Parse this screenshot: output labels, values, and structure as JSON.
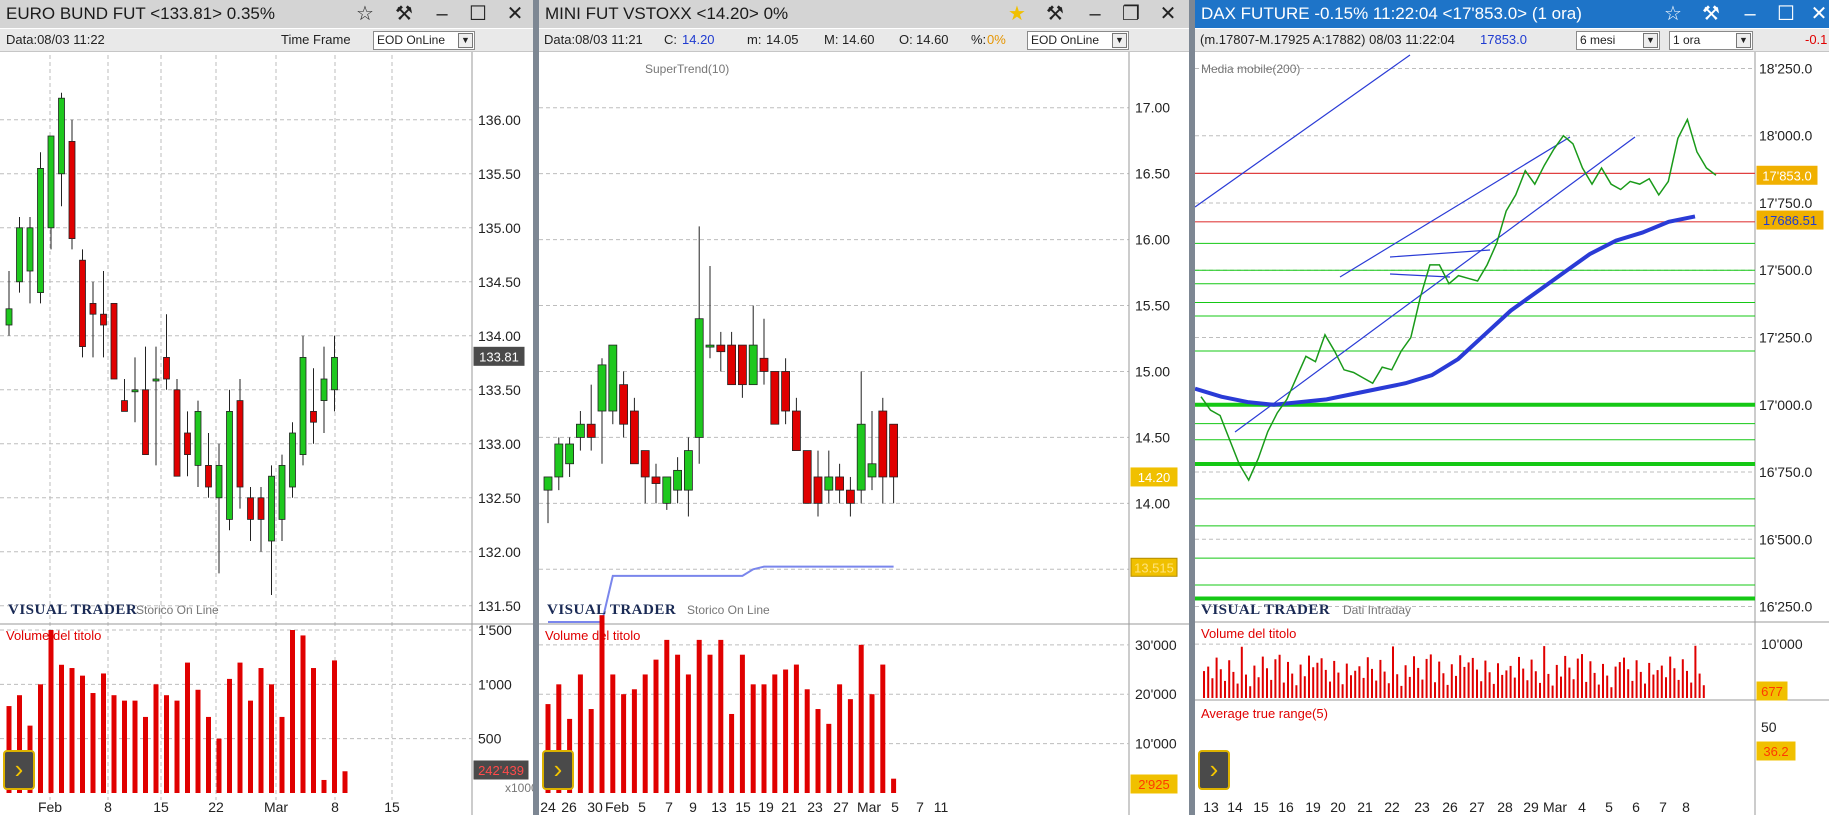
{
  "colors": {
    "up": "#1ec81e",
    "down": "#e00000",
    "title_bg": "#d4d4d4",
    "frame": "#1e74c8",
    "star_active": "#f0c000",
    "sma": "#2a3bd6",
    "supertrend": "#7a86ec"
  },
  "icons": {
    "star": "star-icon",
    "pin": "pin-icon",
    "minimize": "minimize-icon",
    "maximize": "maximize-icon",
    "restore": "restore-icon",
    "close": "close-icon",
    "nav": "chevron-right-icon"
  },
  "brand": {
    "name": "VISUAL TRADER"
  },
  "pane1": {
    "title": "EURO BUND FUT <133.81> 0.35%",
    "info": {
      "data": "Data:08/03 11:22",
      "timeframe_label": "Time Frame",
      "timeframe_value": "EOD OnLine"
    },
    "brand_sub": "Storico On Line",
    "price_badge": "133.81",
    "volume_label": "Volume del titolo",
    "volume_badge": "242'439",
    "volume_unit": "x1000",
    "chart_data": {
      "type": "candlestick",
      "title": "EURO BUND FUT",
      "y_ticks": [
        "136.00",
        "135.50",
        "135.00",
        "134.50",
        "134.00",
        "133.50",
        "133.00",
        "132.50",
        "132.00",
        "131.50"
      ],
      "ylim": [
        131.35,
        136.6
      ],
      "x_labels": [
        "Feb",
        "8",
        "15",
        "22",
        "Mar",
        "8",
        "15"
      ],
      "candles": [
        {
          "o": 134.1,
          "h": 134.6,
          "l": 134.0,
          "c": 134.25
        },
        {
          "o": 134.5,
          "h": 135.1,
          "l": 134.4,
          "c": 135.0
        },
        {
          "o": 134.6,
          "h": 135.1,
          "l": 134.3,
          "c": 135.0
        },
        {
          "o": 134.4,
          "h": 135.7,
          "l": 134.3,
          "c": 135.55
        },
        {
          "o": 135.0,
          "h": 135.85,
          "l": 134.8,
          "c": 135.85
        },
        {
          "o": 135.5,
          "h": 136.25,
          "l": 135.2,
          "c": 136.2
        },
        {
          "o": 135.8,
          "h": 136.0,
          "l": 134.8,
          "c": 134.9
        },
        {
          "o": 134.7,
          "h": 134.8,
          "l": 133.8,
          "c": 133.9
        },
        {
          "o": 134.3,
          "h": 134.5,
          "l": 133.8,
          "c": 134.2
        },
        {
          "o": 134.2,
          "h": 134.6,
          "l": 133.8,
          "c": 134.1
        },
        {
          "o": 134.3,
          "h": 134.3,
          "l": 133.6,
          "c": 133.6
        },
        {
          "o": 133.4,
          "h": 133.6,
          "l": 133.3,
          "c": 133.3
        },
        {
          "o": 133.5,
          "h": 133.8,
          "l": 133.2,
          "c": 133.5
        },
        {
          "o": 133.5,
          "h": 133.9,
          "l": 132.9,
          "c": 132.9
        },
        {
          "o": 133.6,
          "h": 133.9,
          "l": 132.8,
          "c": 133.6
        },
        {
          "o": 133.8,
          "h": 134.2,
          "l": 133.5,
          "c": 133.6
        },
        {
          "o": 133.5,
          "h": 133.6,
          "l": 132.7,
          "c": 132.7
        },
        {
          "o": 133.1,
          "h": 133.3,
          "l": 132.7,
          "c": 132.9
        },
        {
          "o": 132.8,
          "h": 133.4,
          "l": 132.6,
          "c": 133.3
        },
        {
          "o": 132.8,
          "h": 133.1,
          "l": 132.5,
          "c": 132.6
        },
        {
          "o": 132.5,
          "h": 133.0,
          "l": 131.8,
          "c": 132.8
        },
        {
          "o": 132.3,
          "h": 133.5,
          "l": 132.2,
          "c": 133.3
        },
        {
          "o": 133.4,
          "h": 133.6,
          "l": 132.4,
          "c": 132.6
        },
        {
          "o": 132.5,
          "h": 132.6,
          "l": 132.1,
          "c": 132.3
        },
        {
          "o": 132.5,
          "h": 132.6,
          "l": 132.0,
          "c": 132.3
        },
        {
          "o": 132.1,
          "h": 132.8,
          "l": 131.6,
          "c": 132.7
        },
        {
          "o": 132.3,
          "h": 132.9,
          "l": 132.1,
          "c": 132.8
        },
        {
          "o": 132.6,
          "h": 133.2,
          "l": 132.5,
          "c": 133.1
        },
        {
          "o": 132.9,
          "h": 134.0,
          "l": 132.8,
          "c": 133.8
        },
        {
          "o": 133.3,
          "h": 133.7,
          "l": 133.0,
          "c": 133.2
        },
        {
          "o": 133.4,
          "h": 133.9,
          "l": 133.1,
          "c": 133.6
        },
        {
          "o": 133.5,
          "h": 134.0,
          "l": 133.3,
          "c": 133.8
        }
      ],
      "volume_ticks": [
        "1'500",
        "1'000",
        "500"
      ],
      "volume_ylim": [
        0,
        1500
      ],
      "volume": [
        800,
        900,
        620,
        1000,
        1500,
        1180,
        1150,
        1080,
        920,
        1100,
        900,
        850,
        850,
        700,
        1000,
        900,
        850,
        1200,
        950,
        700,
        500,
        1050,
        1200,
        850,
        1150,
        1000,
        700,
        1500,
        1450,
        1150,
        120,
        1220,
        200
      ]
    }
  },
  "pane2": {
    "title": "MINI FUT VSTOXX <14.20> 0%",
    "info": {
      "data": "Data:08/03 11:21",
      "c_label": "C:",
      "c_value": "14.20",
      "m_label": "m:",
      "m_value": "14.05",
      "M_label": "M:",
      "M_value": "14.60",
      "o_label": "O:",
      "o_value": "14.60",
      "pct_label": "%:",
      "pct_value": "0%",
      "timeframe_value": "EOD OnLine"
    },
    "indicator_label": "SuperTrend(10)",
    "brand_sub": "Storico On Line",
    "price_badge": "14.20",
    "supertrend_badge": "13.515",
    "volume_label": "Volume del titolo",
    "volume_badge": "2'925",
    "chart_data": {
      "type": "candlestick",
      "title": "MINI FUT VSTOXX",
      "y_ticks": [
        "17.00",
        "16.50",
        "16.00",
        "15.50",
        "15.00",
        "14.50",
        "14.00"
      ],
      "ylim": [
        13.1,
        17.4
      ],
      "x_labels": [
        "24",
        "26",
        "30",
        "Feb",
        "5",
        "7",
        "9",
        "13",
        "15",
        "19",
        "21",
        "23",
        "27",
        "Mar",
        "5",
        "7",
        "11"
      ],
      "candles": [
        {
          "o": 14.1,
          "h": 14.2,
          "l": 13.85,
          "c": 14.2
        },
        {
          "o": 14.2,
          "h": 14.5,
          "l": 14.1,
          "c": 14.45
        },
        {
          "o": 14.3,
          "h": 14.5,
          "l": 14.2,
          "c": 14.45
        },
        {
          "o": 14.5,
          "h": 14.7,
          "l": 14.4,
          "c": 14.6
        },
        {
          "o": 14.6,
          "h": 14.9,
          "l": 14.4,
          "c": 14.5
        },
        {
          "o": 14.7,
          "h": 15.1,
          "l": 14.3,
          "c": 15.05
        },
        {
          "o": 14.7,
          "h": 15.2,
          "l": 14.6,
          "c": 15.2
        },
        {
          "o": 14.9,
          "h": 15.0,
          "l": 14.5,
          "c": 14.6
        },
        {
          "o": 14.7,
          "h": 14.8,
          "l": 14.3,
          "c": 14.3
        },
        {
          "o": 14.4,
          "h": 14.4,
          "l": 14.0,
          "c": 14.2
        },
        {
          "o": 14.2,
          "h": 14.3,
          "l": 14.0,
          "c": 14.15
        },
        {
          "o": 14.0,
          "h": 14.2,
          "l": 13.95,
          "c": 14.2
        },
        {
          "o": 14.1,
          "h": 14.35,
          "l": 14.0,
          "c": 14.25
        },
        {
          "o": 14.1,
          "h": 14.5,
          "l": 13.9,
          "c": 14.4
        },
        {
          "o": 14.5,
          "h": 16.1,
          "l": 14.3,
          "c": 15.4
        },
        {
          "o": 15.2,
          "h": 15.8,
          "l": 15.1,
          "c": 15.2
        },
        {
          "o": 15.2,
          "h": 15.3,
          "l": 15.0,
          "c": 15.15
        },
        {
          "o": 15.2,
          "h": 15.3,
          "l": 14.9,
          "c": 14.9
        },
        {
          "o": 15.2,
          "h": 15.2,
          "l": 14.8,
          "c": 14.9
        },
        {
          "o": 14.9,
          "h": 15.5,
          "l": 14.9,
          "c": 15.2
        },
        {
          "o": 15.1,
          "h": 15.4,
          "l": 14.9,
          "c": 15.0
        },
        {
          "o": 15.0,
          "h": 15.0,
          "l": 14.6,
          "c": 14.6
        },
        {
          "o": 15.0,
          "h": 15.1,
          "l": 14.6,
          "c": 14.7
        },
        {
          "o": 14.7,
          "h": 14.8,
          "l": 14.4,
          "c": 14.4
        },
        {
          "o": 14.4,
          "h": 14.4,
          "l": 14.0,
          "c": 14.0
        },
        {
          "o": 14.2,
          "h": 14.4,
          "l": 13.9,
          "c": 14.0
        },
        {
          "o": 14.1,
          "h": 14.4,
          "l": 14.0,
          "c": 14.2
        },
        {
          "o": 14.2,
          "h": 14.3,
          "l": 14.0,
          "c": 14.1
        },
        {
          "o": 14.1,
          "h": 14.2,
          "l": 13.9,
          "c": 14.0
        },
        {
          "o": 14.1,
          "h": 15.0,
          "l": 14.0,
          "c": 14.6
        },
        {
          "o": 14.2,
          "h": 14.7,
          "l": 14.1,
          "c": 14.3
        },
        {
          "o": 14.7,
          "h": 14.8,
          "l": 14.0,
          "c": 14.2
        },
        {
          "o": 14.6,
          "h": 14.6,
          "l": 14.0,
          "c": 14.2
        }
      ],
      "supertrend": [
        {
          "i": 0,
          "v": 13.1
        },
        {
          "i": 5,
          "v": 13.1
        },
        {
          "i": 6,
          "v": 13.45
        },
        {
          "i": 18,
          "v": 13.45
        },
        {
          "i": 19,
          "v": 13.5
        },
        {
          "i": 20,
          "v": 13.52
        },
        {
          "i": 32,
          "v": 13.52
        }
      ],
      "volume_ticks": [
        "30'000",
        "20'000",
        "10'000"
      ],
      "volume_ylim": [
        0,
        33000
      ],
      "volume": [
        18000,
        22000,
        15000,
        24000,
        17000,
        36000,
        24000,
        20000,
        21000,
        24000,
        27000,
        31000,
        28000,
        24000,
        31000,
        28000,
        31000,
        16000,
        28000,
        22000,
        22000,
        24000,
        25000,
        26000,
        21000,
        17000,
        14000,
        22000,
        19000,
        30000,
        20000,
        26000,
        2900
      ]
    }
  },
  "pane3": {
    "title": "DAX FUTURE -0.15% 11:22:04  <17'853.0> (1 ora)",
    "info": {
      "text": "(m.17807-M.17925 A:17882) 08/03 11:22:04",
      "price": "17853.0",
      "period": "6 mesi",
      "timeframe": "1 ora",
      "change": "-0.1"
    },
    "indicator_label": "Media mobile(200)",
    "brand_sub": "Dati Intraday",
    "price_badge": "17'853.0",
    "sma_badge": "17686.51",
    "volume_label": "Volume del titolo",
    "volume_badge": "677",
    "atr_label": "Average true range(5)",
    "atr_tick": "50",
    "atr_badge": "36.2",
    "chart_data": {
      "type": "line",
      "title": "DAX FUTURE",
      "y_ticks": [
        "18'250.0",
        "18'000.0",
        "17'750.0",
        "17'500.0",
        "17'250.0",
        "17'000.0",
        "16'750.0",
        "16'500.0",
        "16'250.0"
      ],
      "ylim": [
        16200,
        18300
      ],
      "x_labels": [
        "13",
        "14",
        "15",
        "16",
        "19",
        "20",
        "21",
        "22",
        "23",
        "26",
        "27",
        "28",
        "29",
        "Mar",
        "4",
        "5",
        "6",
        "7",
        "8"
      ],
      "price": [
        17030,
        16980,
        16960,
        16870,
        16780,
        16720,
        16800,
        16900,
        16970,
        17020,
        17100,
        17180,
        17160,
        17260,
        17200,
        17130,
        17120,
        17100,
        17080,
        17140,
        17130,
        17200,
        17250,
        17400,
        17520,
        17520,
        17450,
        17480,
        17470,
        17460,
        17520,
        17600,
        17720,
        17780,
        17870,
        17820,
        17890,
        17950,
        18000,
        17970,
        17880,
        17820,
        17880,
        17820,
        17800,
        17830,
        17820,
        17840,
        17780,
        17830,
        17990,
        18060,
        17940,
        17880,
        17853
      ],
      "sma200": [
        17060,
        17030,
        17010,
        17000,
        17010,
        17020,
        17040,
        17060,
        17080,
        17110,
        17170,
        17260,
        17350,
        17420,
        17490,
        17560,
        17610,
        17640,
        17680,
        17700
      ],
      "volume_ticks": [
        "10'000"
      ],
      "volume_ylim": [
        0,
        13000
      ]
    }
  }
}
